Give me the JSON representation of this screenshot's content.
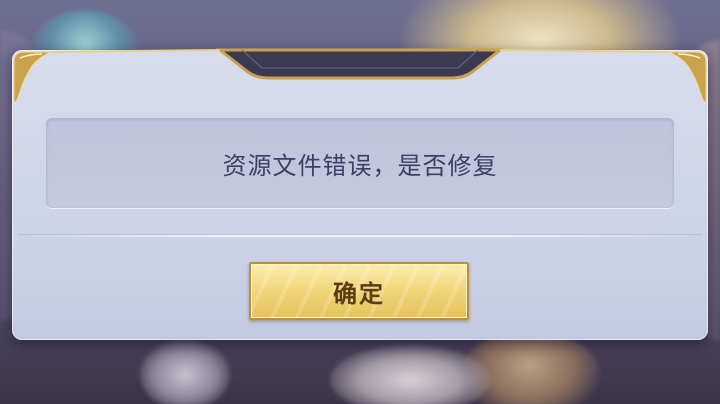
{
  "dialog": {
    "message": "资源文件错误，是否修复",
    "confirm_label": "确定"
  },
  "colors": {
    "dialog_bg": "#d7dced",
    "message_text": "#3a3f63",
    "button_gold": "#f2d77b",
    "frame_gold": "#c9a24e"
  }
}
